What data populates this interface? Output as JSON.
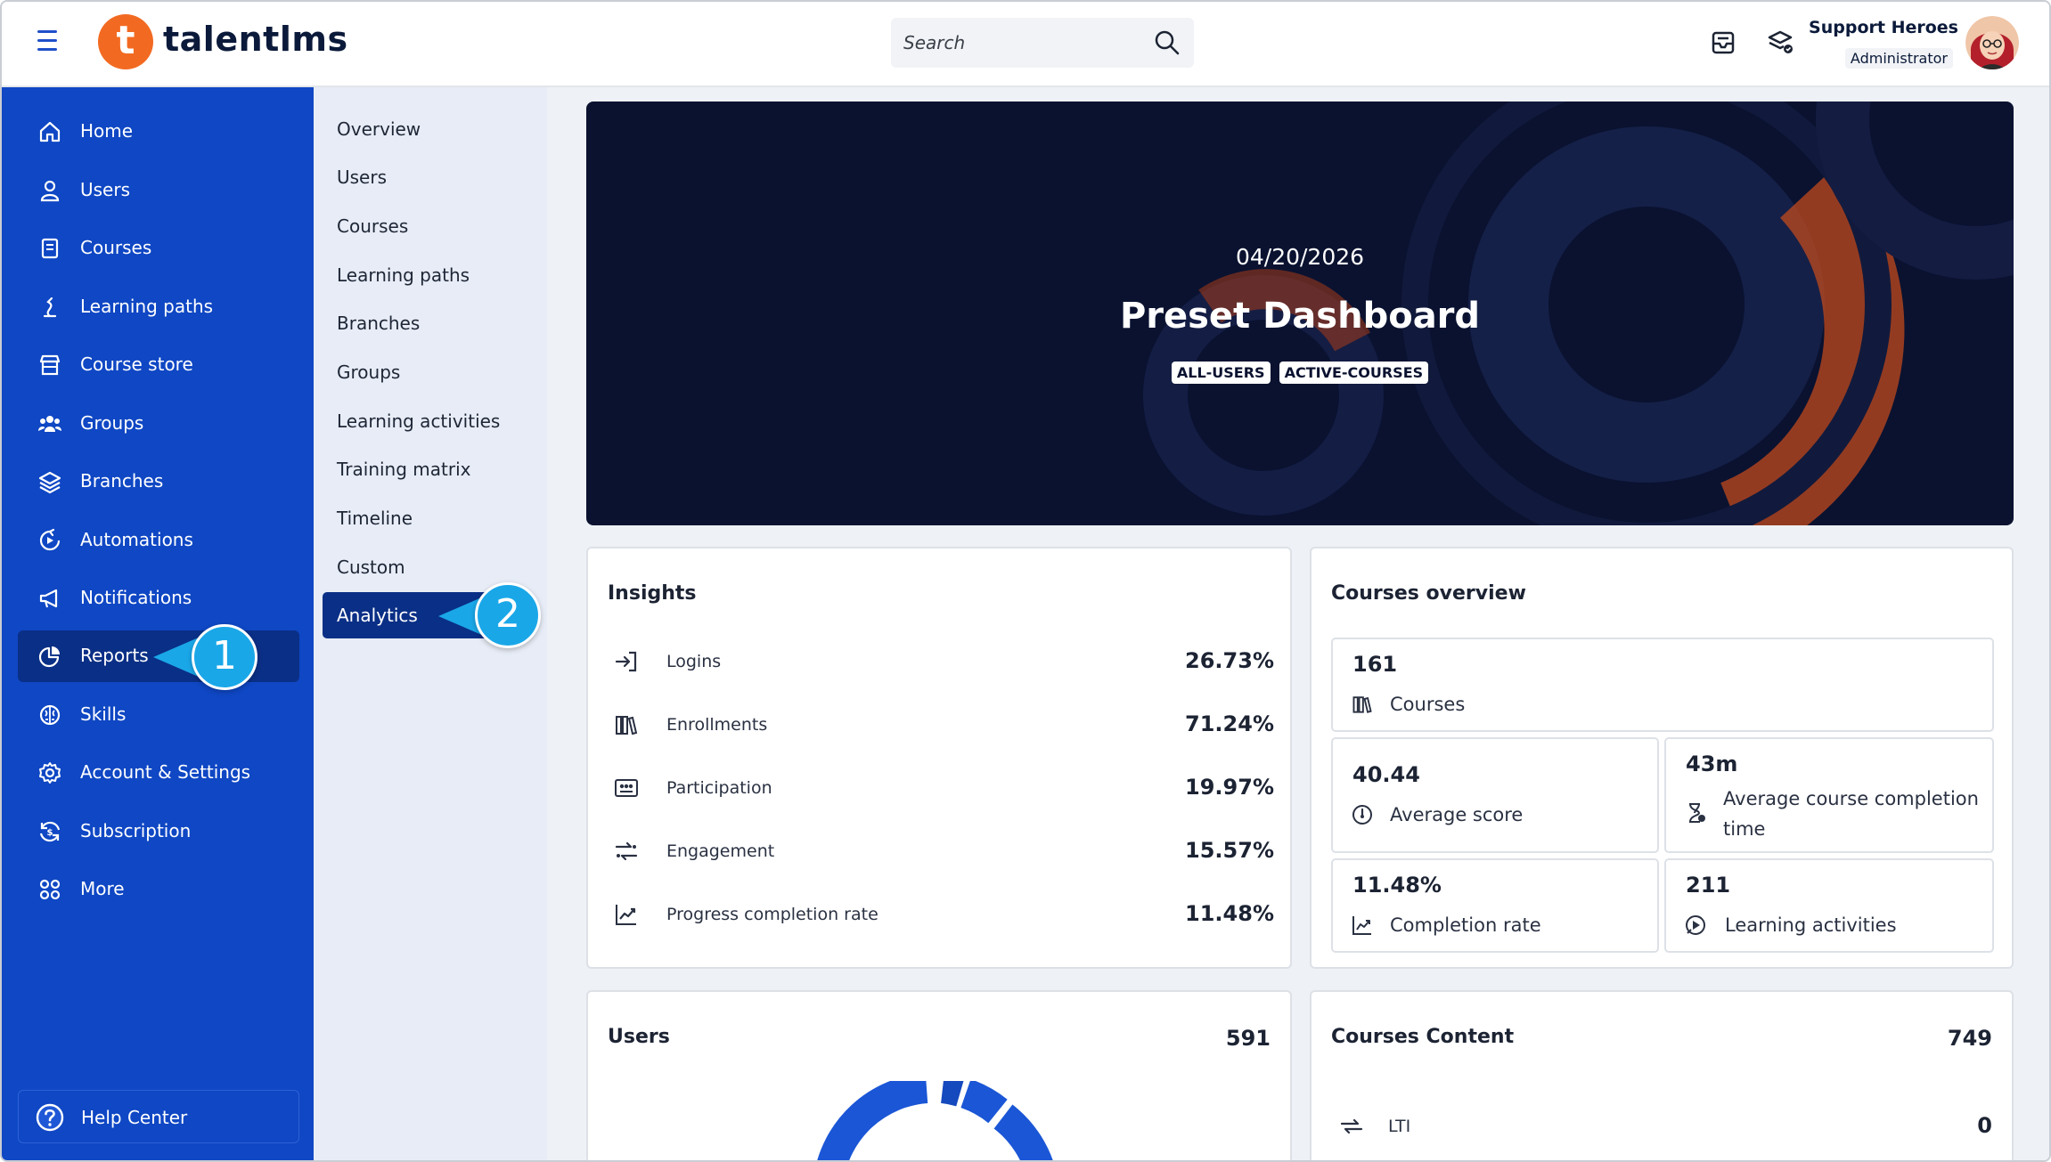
{
  "header": {
    "logo_letter": "t",
    "logo_text": "talentlms",
    "search_placeholder": "Search",
    "user_name": "Support Heroes",
    "user_role": "Administrator"
  },
  "sidebar": {
    "items": [
      {
        "label": "Home",
        "icon": "home-icon"
      },
      {
        "label": "Users",
        "icon": "user-icon"
      },
      {
        "label": "Courses",
        "icon": "book-icon"
      },
      {
        "label": "Learning paths",
        "icon": "path-icon"
      },
      {
        "label": "Course store",
        "icon": "store-icon"
      },
      {
        "label": "Groups",
        "icon": "groups-icon"
      },
      {
        "label": "Branches",
        "icon": "layers-icon"
      },
      {
        "label": "Automations",
        "icon": "automation-icon"
      },
      {
        "label": "Notifications",
        "icon": "megaphone-icon"
      },
      {
        "label": "Reports",
        "icon": "pie-chart-icon",
        "active": true
      },
      {
        "label": "Skills",
        "icon": "brain-icon"
      },
      {
        "label": "Account & Settings",
        "icon": "gear-icon"
      },
      {
        "label": "Subscription",
        "icon": "subscription-icon"
      },
      {
        "label": "More",
        "icon": "grid-icon"
      }
    ],
    "help_label": "Help Center"
  },
  "subnav": {
    "items": [
      "Overview",
      "Users",
      "Courses",
      "Learning paths",
      "Branches",
      "Groups",
      "Learning activities",
      "Training matrix",
      "Timeline",
      "Custom",
      "Analytics"
    ],
    "active": "Analytics"
  },
  "callouts": {
    "first": "1",
    "second": "2"
  },
  "hero": {
    "date": "04/20/2026",
    "title": "Preset Dashboard",
    "tags": [
      "ALL-USERS",
      "ACTIVE-COURSES"
    ]
  },
  "insights": {
    "title": "Insights",
    "rows": [
      {
        "label": "Logins",
        "value": "26.73%"
      },
      {
        "label": "Enrollments",
        "value": "71.24%"
      },
      {
        "label": "Participation",
        "value": "19.97%"
      },
      {
        "label": "Engagement",
        "value": "15.57%"
      },
      {
        "label": "Progress completion rate",
        "value": "11.48%"
      }
    ]
  },
  "courses_overview": {
    "title": "Courses overview",
    "courses": {
      "value": "161",
      "label": "Courses"
    },
    "average_score": {
      "value": "40.44",
      "label": "Average score"
    },
    "avg_completion_time": {
      "value": "43m",
      "label_line1": "Average course completion",
      "label_line2": "time"
    },
    "completion_rate": {
      "value": "11.48%",
      "label": "Completion rate"
    },
    "learning_activities": {
      "value": "211",
      "label": "Learning activities"
    }
  },
  "users_card": {
    "title": "Users",
    "count": "591"
  },
  "courses_content": {
    "title": "Courses Content",
    "count": "749",
    "rows": [
      {
        "label": "LTI",
        "value": "0"
      }
    ]
  },
  "colors": {
    "sidebar": "#0f47c4",
    "sidebar_active": "#0a2f86",
    "logo": "#f26a21",
    "callout": "#1aa7e8",
    "hero": "#0a1230"
  }
}
